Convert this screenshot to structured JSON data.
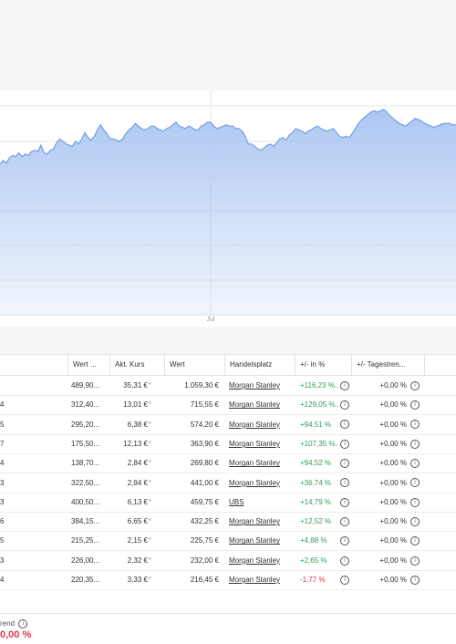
{
  "chart": {
    "x_tick_label": "Jul",
    "fill_color": "#a9c4f2",
    "line_color": "#6f9fea",
    "grid_color": "#e6e6e6",
    "series_level": [
      0.52,
      0.55,
      0.53,
      0.57,
      0.59,
      0.58,
      0.61,
      0.58,
      0.6,
      0.59,
      0.62,
      0.63,
      0.62,
      0.67,
      0.61,
      0.6,
      0.63,
      0.64,
      0.69,
      0.72,
      0.7,
      0.68,
      0.67,
      0.66,
      0.7,
      0.68,
      0.72,
      0.77,
      0.73,
      0.71,
      0.74,
      0.79,
      0.83,
      0.79,
      0.76,
      0.72,
      0.72,
      0.71,
      0.7,
      0.72,
      0.76,
      0.79,
      0.81,
      0.84,
      0.82,
      0.8,
      0.79,
      0.8,
      0.82,
      0.82,
      0.8,
      0.79,
      0.78,
      0.8,
      0.81,
      0.83,
      0.85,
      0.82,
      0.81,
      0.8,
      0.82,
      0.81,
      0.79,
      0.79,
      0.82,
      0.83,
      0.85,
      0.85,
      0.82,
      0.8,
      0.81,
      0.82,
      0.83,
      0.82,
      0.82,
      0.8,
      0.8,
      0.78,
      0.74,
      0.68,
      0.68,
      0.66,
      0.64,
      0.63,
      0.65,
      0.67,
      0.68,
      0.66,
      0.69,
      0.72,
      0.73,
      0.71,
      0.75,
      0.77,
      0.8,
      0.79,
      0.78,
      0.76,
      0.78,
      0.79,
      0.81,
      0.82,
      0.8,
      0.79,
      0.78,
      0.79,
      0.8,
      0.77,
      0.74,
      0.73,
      0.74,
      0.73,
      0.76,
      0.8,
      0.84,
      0.87,
      0.89,
      0.91,
      0.93,
      0.94,
      0.93,
      0.94,
      0.95,
      0.93,
      0.9,
      0.88,
      0.86,
      0.84,
      0.83,
      0.82,
      0.84,
      0.86,
      0.88,
      0.87,
      0.86,
      0.84,
      0.83,
      0.82,
      0.81,
      0.82,
      0.83,
      0.84,
      0.84,
      0.84,
      0.83,
      0.83
    ]
  },
  "table": {
    "columns": [
      "Wert ...",
      "Akt. Kurs",
      "Wert",
      "Handelsplatz",
      "+/- in %",
      "+/- Tagestren..."
    ],
    "rows": [
      {
        "left": "",
        "wert_short": "489,90...",
        "kurs": "35,31 €",
        "star": "*",
        "wert": "1.059,30 €",
        "platz": "Morgan Stanley",
        "pct": "+116,23 %...",
        "pct_sign": "pos",
        "tag": "+0,00 %"
      },
      {
        "left": "4",
        "wert_short": "312,40...",
        "kurs": "13,01 €",
        "star": "*",
        "wert": "715,55 €",
        "platz": "Morgan Stanley",
        "pct": "+129,05 %...",
        "pct_sign": "pos",
        "tag": "+0,00 %"
      },
      {
        "left": "5",
        "wert_short": "295,20...",
        "kurs": "6,38 €",
        "star": "*",
        "wert": "574,20 €",
        "platz": "Morgan Stanley",
        "pct": "+94,51 %",
        "pct_sign": "pos",
        "tag": "+0,00 %"
      },
      {
        "left": "7",
        "wert_short": "175,50...",
        "kurs": "12,13 €",
        "star": "*",
        "wert": "363,90 €",
        "platz": "Morgan Stanley",
        "pct": "+107,35 %...",
        "pct_sign": "pos",
        "tag": "+0,00 %"
      },
      {
        "left": "4",
        "wert_short": "138,70...",
        "kurs": "2,84 €",
        "star": "*",
        "wert": "269,80 €",
        "platz": "Morgan Stanley",
        "pct": "+94,52 %",
        "pct_sign": "pos",
        "tag": "+0,00 %"
      },
      {
        "left": "3",
        "wert_short": "322,50...",
        "kurs": "2,94 €",
        "star": "*",
        "wert": "441,00 €",
        "platz": "Morgan Stanley",
        "pct": "+36,74 %",
        "pct_sign": "pos",
        "tag": "+0,00 %"
      },
      {
        "left": "3",
        "wert_short": "400,50...",
        "kurs": "6,13 €",
        "star": "*",
        "wert": "459,75 €",
        "platz": "UBS",
        "pct": "+14,79 %",
        "pct_sign": "pos",
        "tag": "+0,00 %"
      },
      {
        "left": "6",
        "wert_short": "384,15...",
        "kurs": "6,65 €",
        "star": "*",
        "wert": "432,25 €",
        "platz": "Morgan Stanley",
        "pct": "+12,52 %",
        "pct_sign": "pos",
        "tag": "+0,00 %"
      },
      {
        "left": "5",
        "wert_short": "215,25...",
        "kurs": "2,15 €",
        "star": "*",
        "wert": "225,75 €",
        "platz": "Morgan Stanley",
        "pct": "+4,88 %",
        "pct_sign": "pos",
        "tag": "+0,00 %"
      },
      {
        "left": "3",
        "wert_short": "226,00...",
        "kurs": "2,32 €",
        "star": "*",
        "wert": "232,00 €",
        "platz": "Morgan Stanley",
        "pct": "+2,65 %",
        "pct_sign": "pos",
        "tag": "+0,00 %"
      },
      {
        "left": "4",
        "wert_short": "220,35...",
        "kurs": "3,33 €",
        "star": "*",
        "wert": "216,45 €",
        "platz": "Morgan Stanley",
        "pct": "-1,77 %",
        "pct_sign": "neg",
        "tag": "+0,00 %"
      }
    ],
    "info_icon": "info-icon"
  },
  "footer": {
    "trend_label": "rend",
    "trend_value": "0,00 %"
  },
  "colors": {
    "positive": "#2e9e5b",
    "negative": "#e0394f"
  }
}
